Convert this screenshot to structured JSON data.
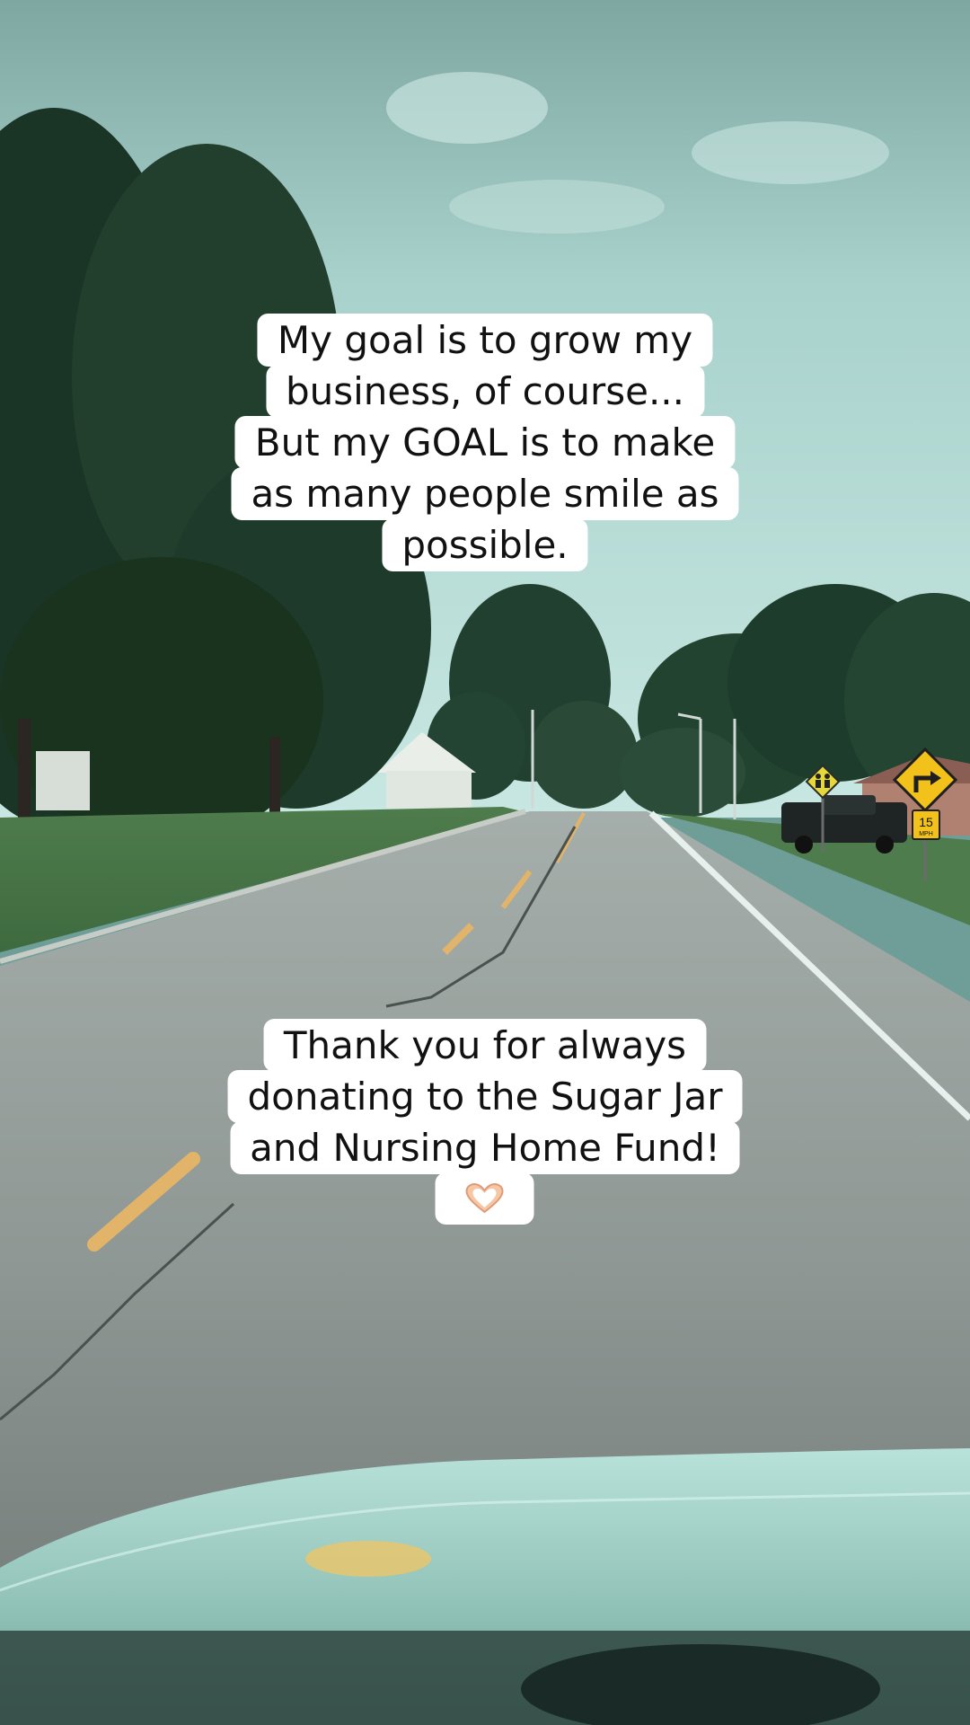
{
  "colors": {
    "sky": "#b9ddd8",
    "tree_dark": "#1f3a2f",
    "grass": "#5f8a55",
    "road": "#8b938f",
    "road_line_yellow": "#e2b46a",
    "road_line_white": "#e8f0ee",
    "caption_bg": "#ffffff",
    "caption_text": "#111111",
    "sign_yellow": "#f2c21b"
  },
  "captions": {
    "top": {
      "lines": [
        "My goal is to grow my",
        "business, of course...",
        "But my GOAL is to make",
        "as many people smile as",
        "possible."
      ]
    },
    "bottom": {
      "lines": [
        "Thank you for always",
        "donating to the Sugar Jar",
        "and Nursing Home Fund!"
      ],
      "emoji": "heart-hands-icon"
    }
  },
  "signs": {
    "school_sign_icon": "school-crossing-icon",
    "turn_sign_icon": "right-turn-arrow-icon",
    "speed_limit_value": "15",
    "speed_limit_unit": "MPH"
  }
}
